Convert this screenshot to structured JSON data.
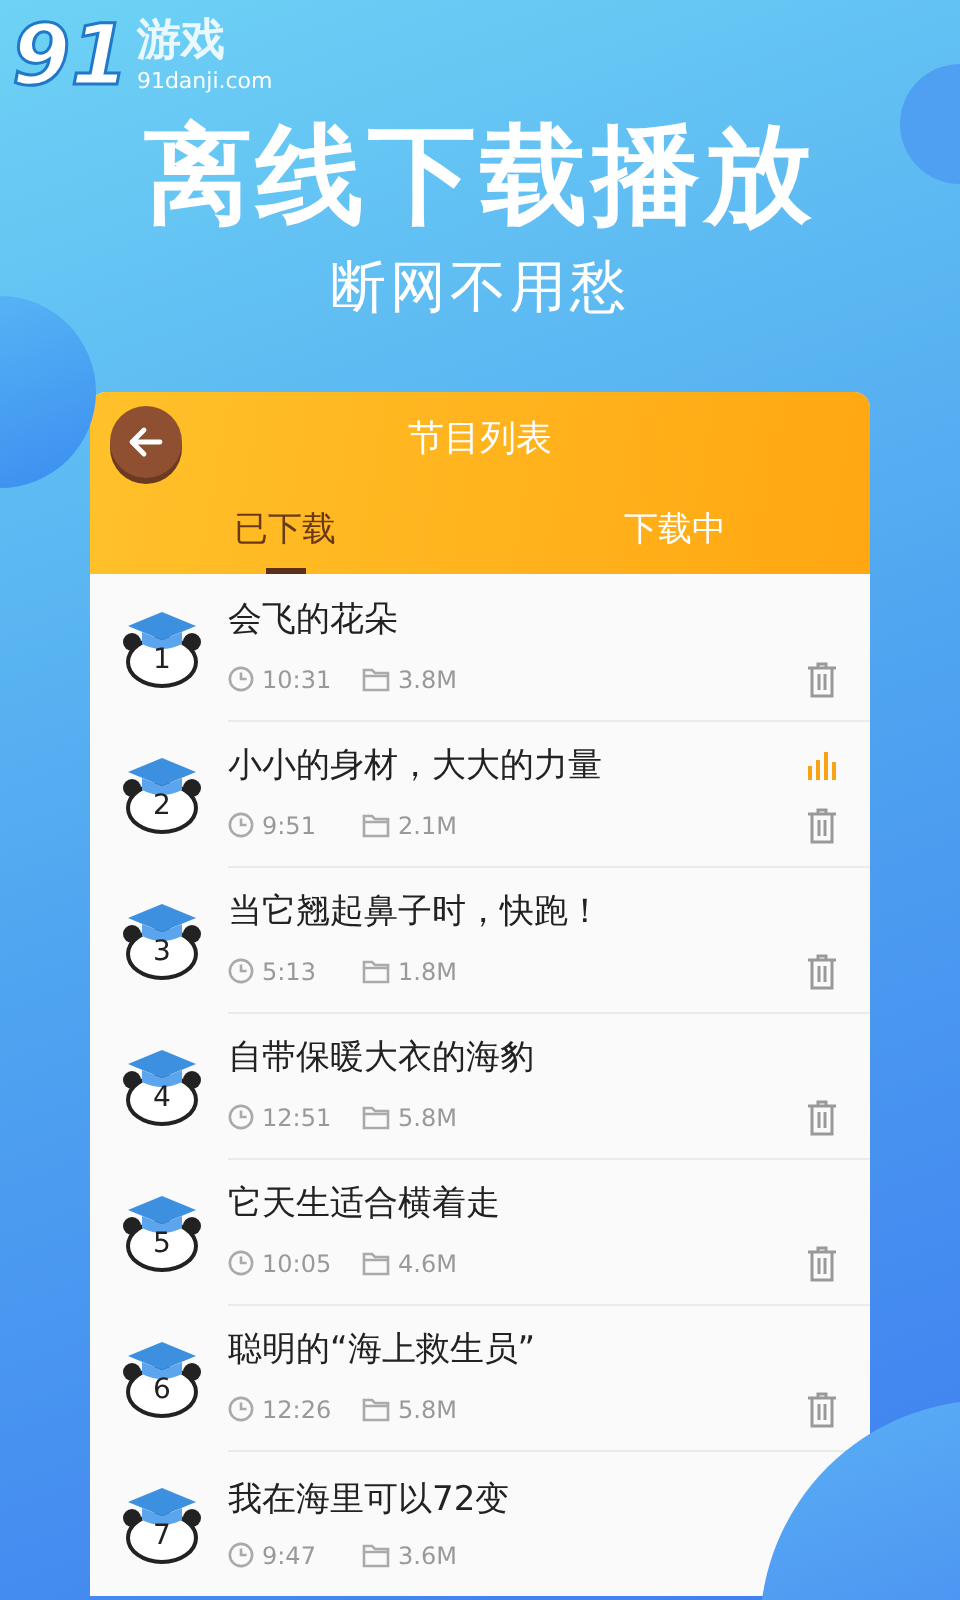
{
  "logo": {
    "mark": "91",
    "name": "游戏",
    "domain": "91danji.com"
  },
  "headline": "离线下载播放",
  "subheadline": "断网不用愁",
  "screen": {
    "title": "节目列表",
    "tabs": [
      {
        "label": "已下载",
        "selected": true
      },
      {
        "label": "下载中",
        "selected": false
      }
    ],
    "items": [
      {
        "number": "1",
        "title": "会飞的花朵",
        "duration": "10:31",
        "size": "3.8M",
        "playing": false,
        "trash": true
      },
      {
        "number": "2",
        "title": "小小的身材，大大的力量",
        "duration": "9:51",
        "size": "2.1M",
        "playing": true,
        "trash": true
      },
      {
        "number": "3",
        "title": "当它翘起鼻子时，快跑！",
        "duration": "5:13",
        "size": "1.8M",
        "playing": false,
        "trash": true
      },
      {
        "number": "4",
        "title": "自带保暖大衣的海豹",
        "duration": "12:51",
        "size": "5.8M",
        "playing": false,
        "trash": true
      },
      {
        "number": "5",
        "title": "它天生适合横着走",
        "duration": "10:05",
        "size": "4.6M",
        "playing": false,
        "trash": true
      },
      {
        "number": "6",
        "title": "聪明的“海上救生员”",
        "duration": "12:26",
        "size": "5.8M",
        "playing": false,
        "trash": true
      },
      {
        "number": "7",
        "title": "我在海里可以72变",
        "duration": "9:47",
        "size": "3.6M"
      }
    ]
  }
}
